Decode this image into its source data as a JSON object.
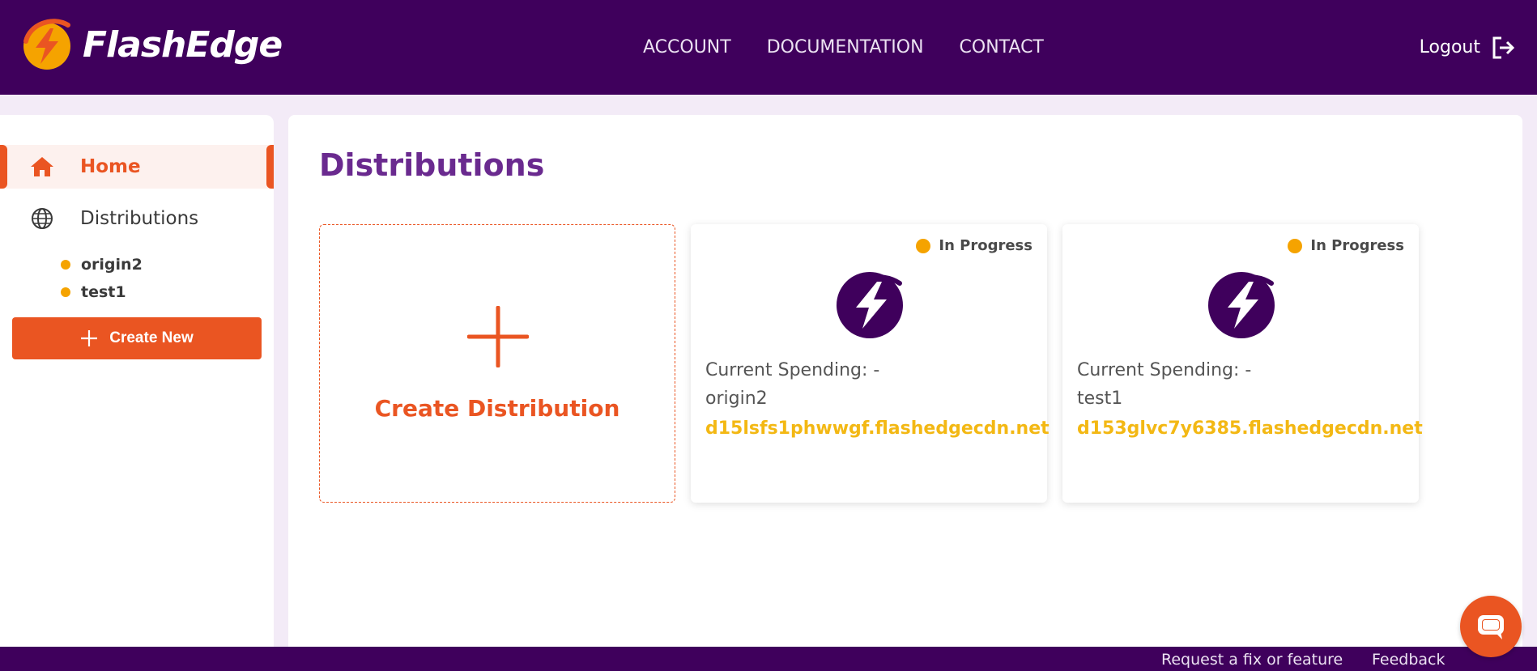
{
  "brand": {
    "name": "FlashEdge",
    "logo_icon": "lightning-bolt-logo-icon"
  },
  "nav": {
    "links": [
      "ACCOUNT",
      "DOCUMENTATION",
      "CONTACT"
    ],
    "logout_label": "Logout",
    "logout_icon": "logout-icon"
  },
  "sidebar": {
    "home_label": "Home",
    "distributions_label": "Distributions",
    "sub_items": [
      "origin2",
      "test1"
    ],
    "create_new_label": "Create New"
  },
  "main": {
    "title": "Distributions",
    "create_card_label": "Create Distribution",
    "cards": [
      {
        "status": "In Progress",
        "spending": "Current Spending: -",
        "origin": "origin2",
        "domain": "d15lsfs1phwwgf.flashedgecdn.net"
      },
      {
        "status": "In Progress",
        "spending": "Current Spending: -",
        "origin": "test1",
        "domain": "d153glvc7y6385.flashedgecdn.net"
      }
    ]
  },
  "footer": {
    "request_fix_label": "Request a fix or feature",
    "feedback_label": "Feedback"
  },
  "colors": {
    "brand_purple": "#3f005c",
    "accent_orange": "#ea5522",
    "status_orange": "#f5a300",
    "domain_yellow": "#f3b814",
    "title_purple": "#6a2a8f"
  }
}
